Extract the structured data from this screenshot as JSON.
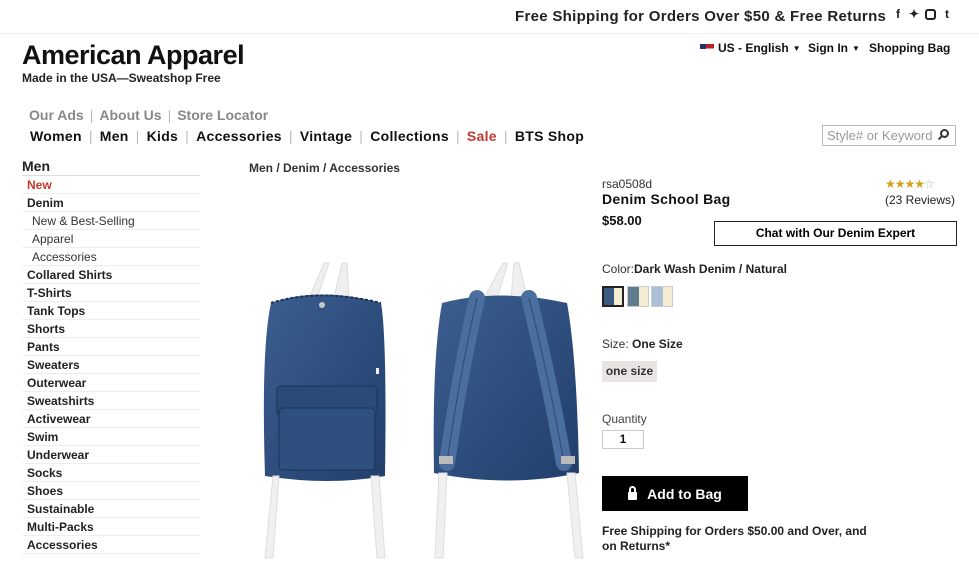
{
  "header": {
    "promo": "Free Shipping for Orders Over $50 & Free Returns",
    "social_icons": [
      "facebook-icon",
      "twitter-icon",
      "instagram-icon",
      "tumblr-icon"
    ],
    "logo": "American Apparel",
    "tagline": "Made in the USA—Sweatshop Free",
    "locale": "US - English",
    "sign_in": "Sign In",
    "shopping_bag": "Shopping Bag",
    "secondary_nav": [
      "Our Ads",
      "About Us",
      "Store Locator"
    ],
    "main_nav": [
      "Women",
      "Men",
      "Kids",
      "Accessories",
      "Vintage",
      "Collections",
      "Sale",
      "BTS Shop"
    ],
    "search_placeholder": "Style# or Keyword"
  },
  "sidebar": {
    "title": "Men",
    "items": [
      {
        "label": "New"
      },
      {
        "label": "Denim"
      },
      {
        "label": "New & Best-Selling"
      },
      {
        "label": "Apparel"
      },
      {
        "label": "Accessories"
      },
      {
        "label": "Collared Shirts"
      },
      {
        "label": "T-Shirts"
      },
      {
        "label": "Tank Tops"
      },
      {
        "label": "Shorts"
      },
      {
        "label": "Pants"
      },
      {
        "label": "Sweaters"
      },
      {
        "label": "Outerwear"
      },
      {
        "label": "Sweatshirts"
      },
      {
        "label": "Activewear"
      },
      {
        "label": "Swim"
      },
      {
        "label": "Underwear"
      },
      {
        "label": "Socks"
      },
      {
        "label": "Shoes"
      },
      {
        "label": "Sustainable"
      },
      {
        "label": "Multi-Packs"
      },
      {
        "label": "Accessories"
      }
    ]
  },
  "breadcrumb": "Men / Denim / Accessories",
  "product": {
    "sku": "rsa0508d",
    "name": "Denim School Bag",
    "price": "$58.00",
    "rating_stars": 4,
    "reviews": "(23 Reviews)",
    "chat_button": "Chat with Our Denim Expert",
    "color_label": "Color:",
    "color_value": "Dark Wash Denim / Natural",
    "swatch_colors": [
      "#3b5a82",
      "#5f7d8e",
      "#a9bfd4"
    ],
    "size_label": "Size:",
    "size_value": "One Size",
    "size_option": "one size",
    "quantity_label": "Quantity",
    "quantity_value": "1",
    "add_to_bag": "Add to Bag",
    "shipping_note": "Free Shipping for Orders $50.00 and Over, and on Returns*"
  },
  "colors": {
    "denim": "#2f4f7f",
    "denim_dark": "#1f3a63",
    "sale": "#c0392b",
    "cream": "#f3ecd2"
  }
}
